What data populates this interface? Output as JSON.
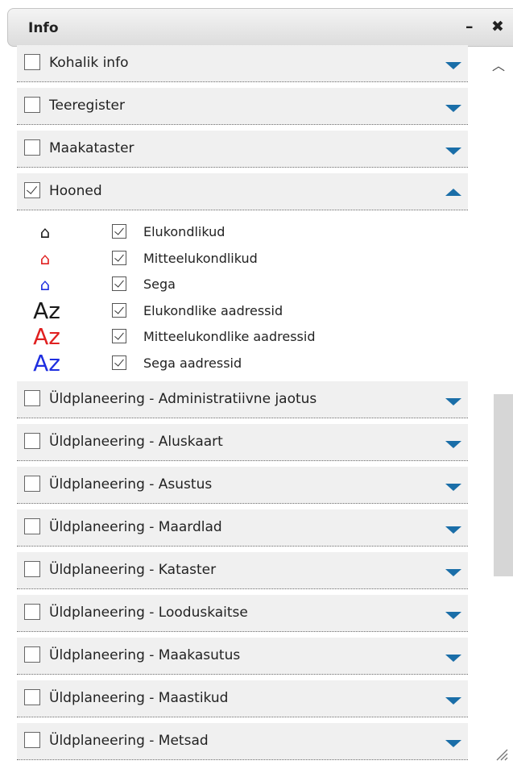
{
  "header": {
    "title": "Info",
    "minimize_label": "–",
    "close_label": "✖"
  },
  "layers": [
    {
      "label": "Kohalik info",
      "checked": false,
      "expanded": false
    },
    {
      "label": "Teeregister",
      "checked": false,
      "expanded": false
    },
    {
      "label": "Maakataster",
      "checked": false,
      "expanded": false
    },
    {
      "label": "Hooned",
      "checked": true,
      "expanded": true
    },
    {
      "label": "Üldplaneering - Administratiivne jaotus",
      "checked": false,
      "expanded": false
    },
    {
      "label": "Üldplaneering - Aluskaart",
      "checked": false,
      "expanded": false
    },
    {
      "label": "Üldplaneering - Asustus",
      "checked": false,
      "expanded": false
    },
    {
      "label": "Üldplaneering - Maardlad",
      "checked": false,
      "expanded": false
    },
    {
      "label": "Üldplaneering - Kataster",
      "checked": false,
      "expanded": false
    },
    {
      "label": "Üldplaneering - Looduskaitse",
      "checked": false,
      "expanded": false
    },
    {
      "label": "Üldplaneering - Maakasutus",
      "checked": false,
      "expanded": false
    },
    {
      "label": "Üldplaneering - Maastikud",
      "checked": false,
      "expanded": false
    },
    {
      "label": "Üldplaneering - Metsad",
      "checked": false,
      "expanded": false
    }
  ],
  "sublayers": [
    {
      "label": "Elukondlikud",
      "icon": "house-icon",
      "color": "#1a1a1a",
      "glyph": "⌂"
    },
    {
      "label": "Mitteelukondlikud",
      "icon": "house-icon",
      "color": "#e02020",
      "glyph": "⌂"
    },
    {
      "label": "Sega",
      "icon": "house-icon",
      "color": "#1f2fe0",
      "glyph": "⌂"
    },
    {
      "label": "Elukondlike aadressid",
      "icon": "address-icon",
      "color": "#1a1a1a",
      "glyph": "Az"
    },
    {
      "label": "Mitteelukondlike aadressid",
      "icon": "address-icon",
      "color": "#e02020",
      "glyph": "Az"
    },
    {
      "label": "Sega aadressid",
      "icon": "address-icon",
      "color": "#1f2fe0",
      "glyph": "Az"
    }
  ],
  "colors": {
    "arrow": "#1a6ea8",
    "row_bg": "#f0f0f0"
  }
}
